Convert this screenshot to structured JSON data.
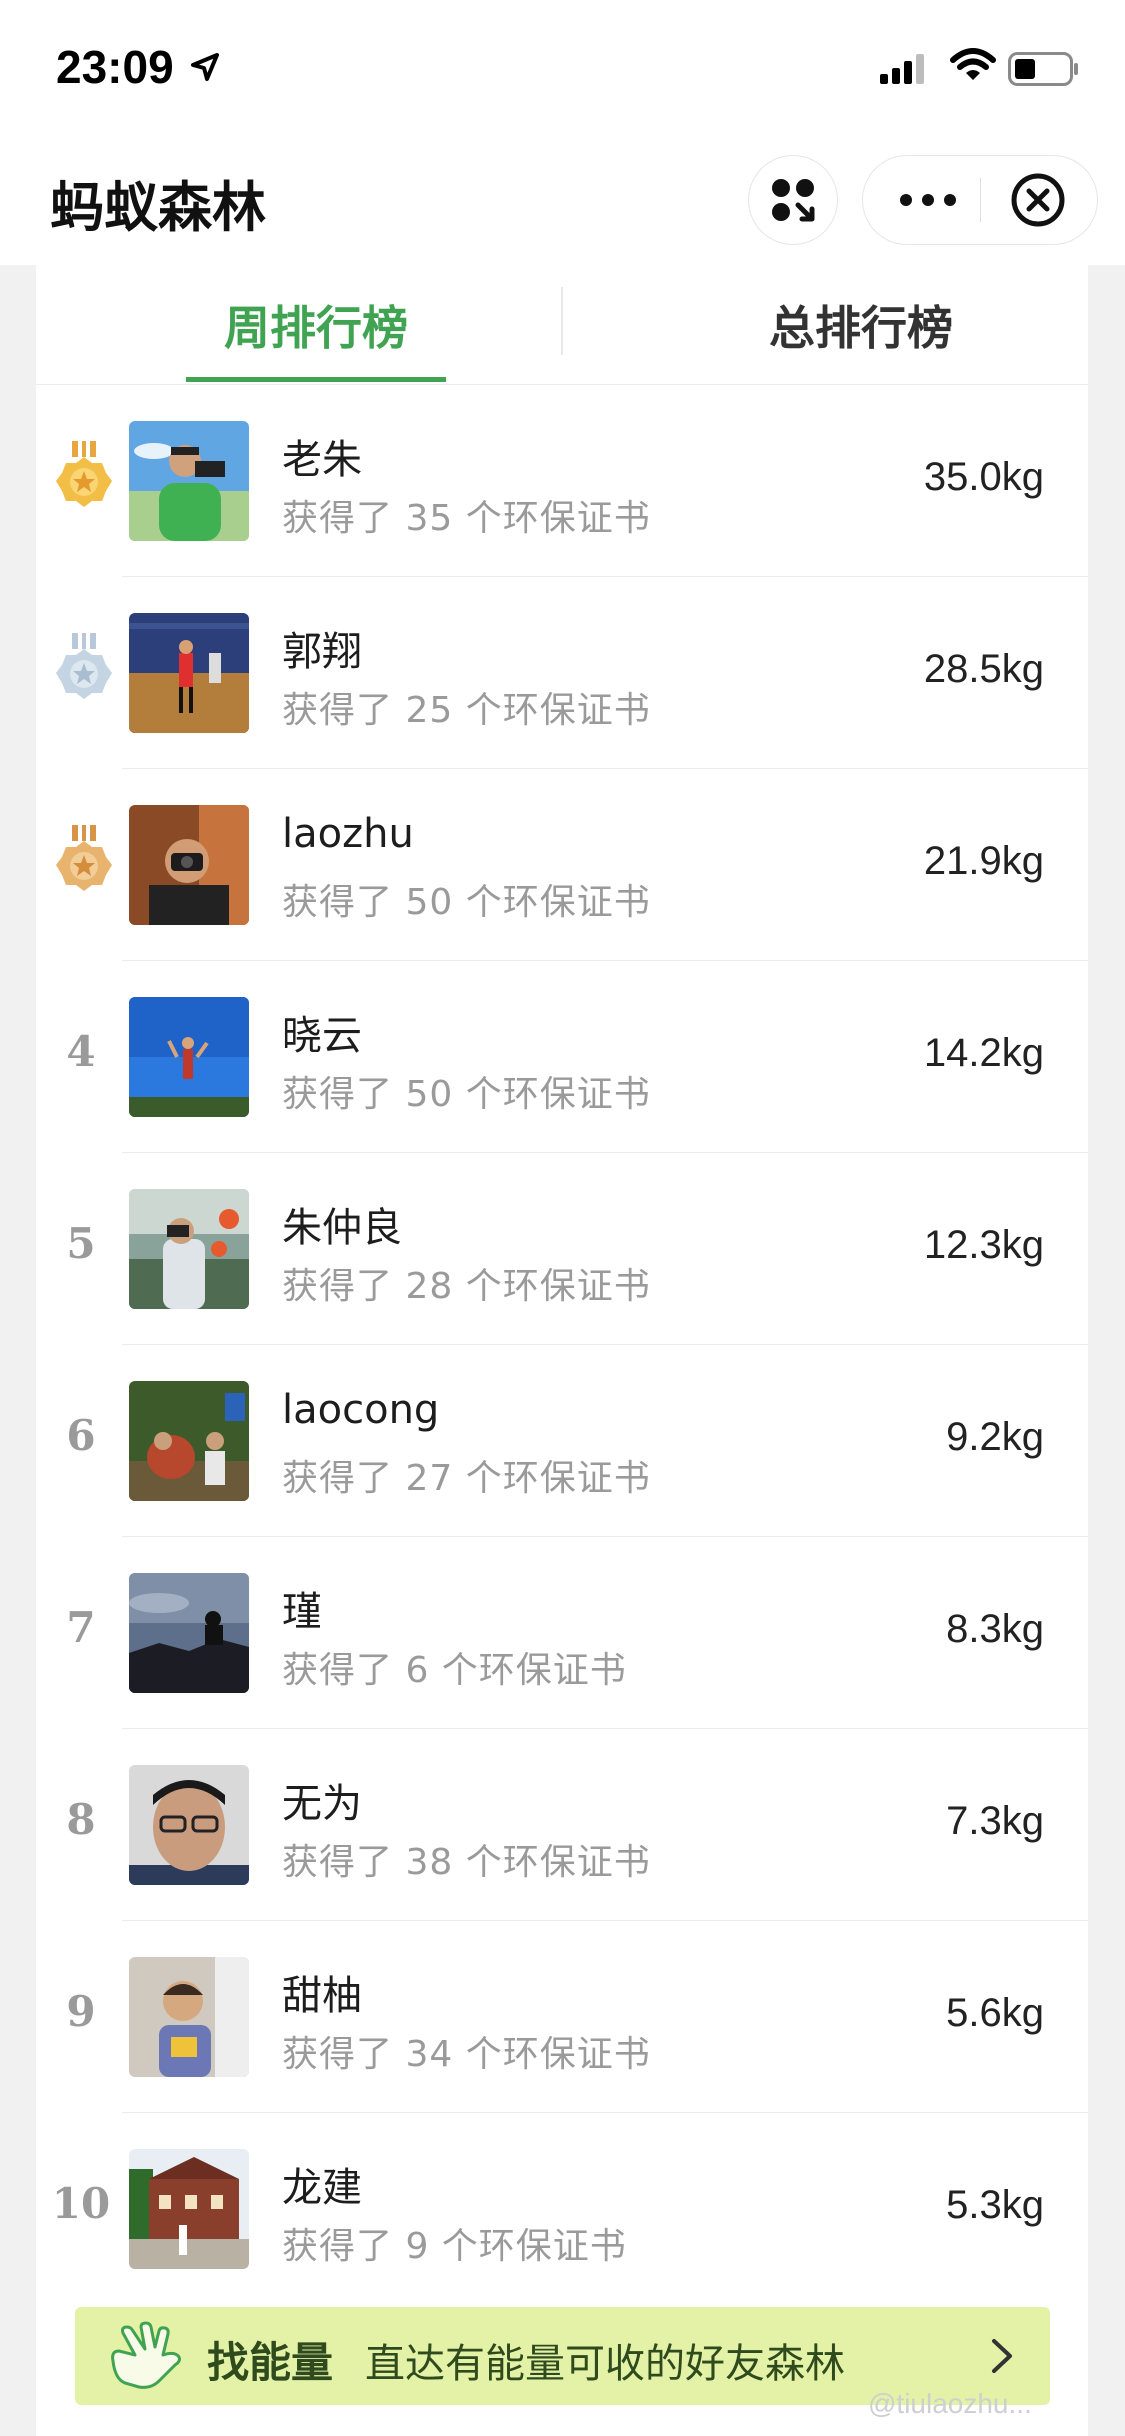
{
  "status_bar": {
    "time": "23:09"
  },
  "nav": {
    "title": "蚂蚁森林"
  },
  "tabs": [
    {
      "label": "周排行榜",
      "active": true
    },
    {
      "label": "总排行榜",
      "active": false
    }
  ],
  "colors": {
    "accent": "#3fa352",
    "gold": "#f0b43a",
    "silver": "#c5d4e2",
    "bronze": "#e1a65c",
    "banner_bg": "#e3f2a7"
  },
  "rankings": [
    {
      "rank": "1",
      "medal": "gold",
      "name": "老朱",
      "desc": "获得了 35 个环保证书",
      "energy": "35.0kg"
    },
    {
      "rank": "2",
      "medal": "silver",
      "name": "郭翔",
      "desc": "获得了 25 个环保证书",
      "energy": "28.5kg"
    },
    {
      "rank": "3",
      "medal": "bronze",
      "name": "laozhu",
      "desc": "获得了 50 个环保证书",
      "energy": "21.9kg"
    },
    {
      "rank": "4",
      "name": "晓云",
      "desc": "获得了 50 个环保证书",
      "energy": "14.2kg"
    },
    {
      "rank": "5",
      "name": "朱仲良",
      "desc": "获得了 28 个环保证书",
      "energy": "12.3kg"
    },
    {
      "rank": "6",
      "name": "laocong",
      "desc": "获得了 27 个环保证书",
      "energy": "9.2kg"
    },
    {
      "rank": "7",
      "name": "瑾",
      "desc": "获得了 6 个环保证书",
      "energy": "8.3kg"
    },
    {
      "rank": "8",
      "name": "无为",
      "desc": "获得了 38 个环保证书",
      "energy": "7.3kg"
    },
    {
      "rank": "9",
      "name": "甜柚",
      "desc": "获得了 34 个环保证书",
      "energy": "5.6kg"
    },
    {
      "rank": "10",
      "name": "龙建",
      "desc": "获得了 9 个环保证书",
      "energy": "5.3kg"
    }
  ],
  "banner": {
    "title": "找能量",
    "desc": "直达有能量可收的好友森林"
  },
  "watermark": "@tiulaozhu..."
}
